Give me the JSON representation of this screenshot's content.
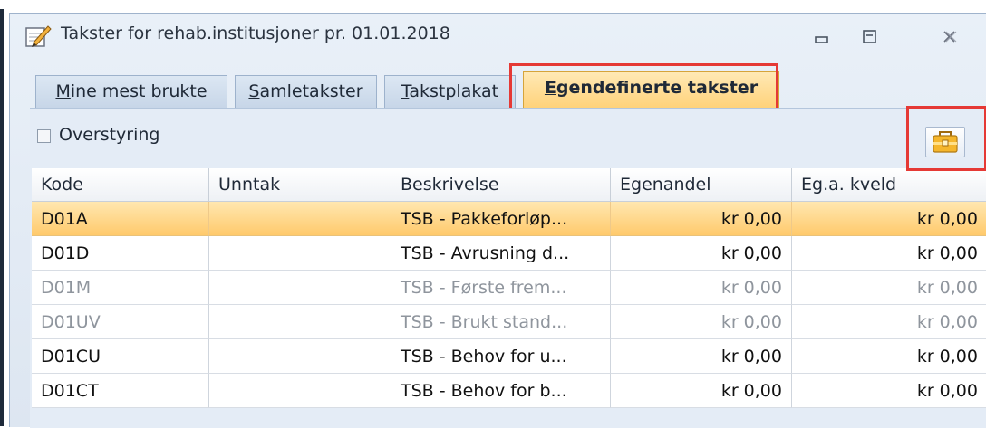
{
  "window": {
    "title": "Takster for rehab.institusjoner pr. 01.01.2018"
  },
  "tabs": [
    {
      "label": "Mine mest brukte",
      "accel": "M",
      "rest": "ine mest brukte",
      "active": false
    },
    {
      "label": "Samletakster",
      "accel": "S",
      "rest": "amletakster",
      "active": false
    },
    {
      "label": "Takstplakat",
      "accel": "T",
      "rest": "akstplakat",
      "active": false
    },
    {
      "label": "Egendefinerte takster",
      "accel": "E",
      "rest": "gendefinerte takster",
      "active": true
    }
  ],
  "overstyring": {
    "label": "Overstyring",
    "checked": false
  },
  "toolbar": {
    "button_icon": "briefcase-icon"
  },
  "table": {
    "columns": [
      "Kode",
      "Unntak",
      "Beskrivelse",
      "Egenandel",
      "Eg.a. kveld"
    ],
    "rows": [
      {
        "kode": "D01A",
        "unntak": "",
        "beskrivelse": "TSB - Pakkeforløp...",
        "egenandel": "kr 0,00",
        "kveld": "kr 0,00",
        "state": "selected"
      },
      {
        "kode": "D01D",
        "unntak": "",
        "beskrivelse": "TSB - Avrusning d...",
        "egenandel": "kr 0,00",
        "kveld": "kr 0,00",
        "state": "normal"
      },
      {
        "kode": "D01M",
        "unntak": "",
        "beskrivelse": "TSB - Første frem...",
        "egenandel": "kr 0,00",
        "kveld": "kr 0,00",
        "state": "disabled"
      },
      {
        "kode": "D01UV",
        "unntak": "",
        "beskrivelse": "TSB - Brukt stand...",
        "egenandel": "kr 0,00",
        "kveld": "kr 0,00",
        "state": "disabled"
      },
      {
        "kode": "D01CU",
        "unntak": "",
        "beskrivelse": "TSB - Behov for u...",
        "egenandel": "kr 0,00",
        "kveld": "kr 0,00",
        "state": "normal"
      },
      {
        "kode": "D01CT",
        "unntak": "",
        "beskrivelse": "TSB - Behov for b...",
        "egenandel": "kr 0,00",
        "kveld": "kr 0,00",
        "state": "normal"
      }
    ]
  },
  "colors": {
    "highlight_box": "#e53935",
    "selected_row": "#ffc96a",
    "active_tab": "#ffd27a",
    "window_bg": "#dde6f1"
  }
}
